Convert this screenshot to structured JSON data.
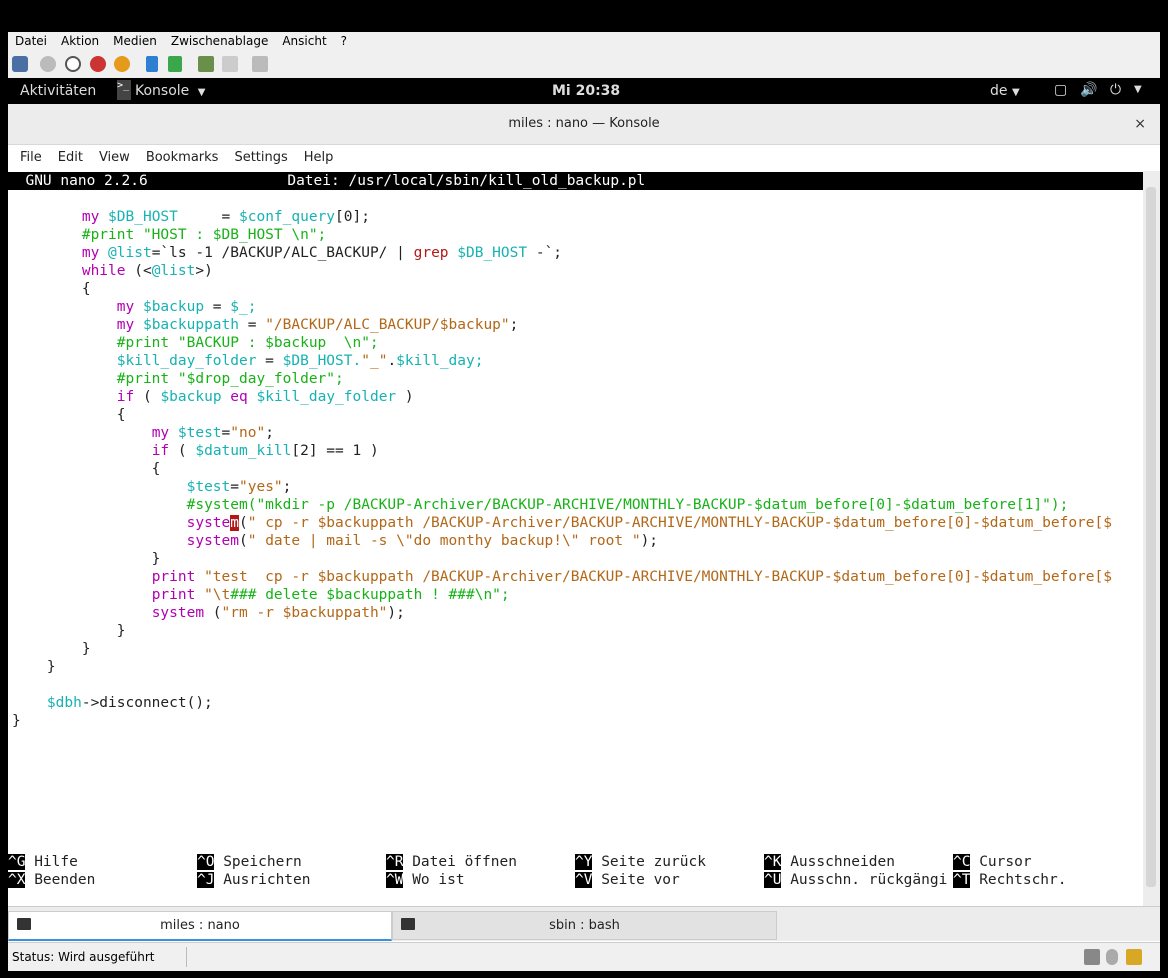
{
  "vm": {
    "menu": [
      "Datei",
      "Aktion",
      "Medien",
      "Zwischenablage",
      "Ansicht",
      "?"
    ],
    "status": "Status: Wird ausgeführt"
  },
  "gnome": {
    "activities": "Aktivitäten",
    "app_name": "Konsole",
    "clock": "Mi 20:38",
    "lang": "de",
    "app_icon_text": ">_"
  },
  "window": {
    "title": "miles : nano — Konsole",
    "close": "×",
    "menu": [
      "File",
      "Edit",
      "View",
      "Bookmarks",
      "Settings",
      "Help"
    ]
  },
  "nano": {
    "header": "  GNU nano 2.2.6                Datei: /usr/local/sbin/kill_old_backup.pl",
    "help": [
      {
        "key": "^G",
        "label": "Hilfe"
      },
      {
        "key": "^O",
        "label": "Speichern"
      },
      {
        "key": "^R",
        "label": "Datei öffnen"
      },
      {
        "key": "^Y",
        "label": "Seite zurück"
      },
      {
        "key": "^K",
        "label": "Ausschneiden"
      },
      {
        "key": "^C",
        "label": "Cursor"
      },
      {
        "key": "^X",
        "label": "Beenden"
      },
      {
        "key": "^J",
        "label": "Ausrichten"
      },
      {
        "key": "^W",
        "label": "Wo ist"
      },
      {
        "key": "^V",
        "label": "Seite vor"
      },
      {
        "key": "^U",
        "label": "Ausschn. rückgängi"
      },
      {
        "key": "^T",
        "label": "Rechtschr."
      }
    ]
  },
  "code": [
    [
      [
        "",
        "        "
      ],
      [
        "kw",
        "my "
      ],
      [
        "var",
        "$DB_HOST"
      ],
      [
        "",
        "     = "
      ],
      [
        "var",
        "$conf_query"
      ],
      [
        "",
        "[0];"
      ]
    ],
    [
      [
        "",
        "        "
      ],
      [
        "cm",
        "#print \"HOST : $DB_HOST \\n\";"
      ]
    ],
    [
      [
        "",
        "        "
      ],
      [
        "kw",
        "my "
      ],
      [
        "var",
        "@list"
      ],
      [
        "",
        "=`ls -1 /BACKUP/ALC_BACKUP/ | "
      ],
      [
        "op",
        "grep"
      ],
      [
        "",
        " "
      ],
      [
        "var",
        "$DB_HOST"
      ],
      [
        "",
        " -`;"
      ]
    ],
    [
      [
        "",
        "        "
      ],
      [
        "kw",
        "while"
      ],
      [
        "",
        " (<"
      ],
      [
        "var",
        "@list"
      ],
      [
        "",
        ">)"
      ]
    ],
    [
      [
        "",
        "        {"
      ]
    ],
    [
      [
        "",
        "            "
      ],
      [
        "kw",
        "my "
      ],
      [
        "var",
        "$backup"
      ],
      [
        "",
        " = "
      ],
      [
        "var",
        "$_;"
      ]
    ],
    [
      [
        "",
        "            "
      ],
      [
        "kw",
        "my "
      ],
      [
        "var",
        "$backuppath"
      ],
      [
        "",
        " = "
      ],
      [
        "str",
        "\"/BACKUP/ALC_BACKUP/$backup\""
      ],
      [
        "",
        ";"
      ]
    ],
    [
      [
        "",
        "            "
      ],
      [
        "cm",
        "#print \"BACKUP : $backup  \\n\";"
      ]
    ],
    [
      [
        "",
        "            "
      ],
      [
        "var",
        "$kill_day_folder"
      ],
      [
        "",
        " = "
      ],
      [
        "var",
        "$DB_HOST."
      ],
      [
        "str",
        "\"_\""
      ],
      [
        "",
        "."
      ],
      [
        "var",
        "$kill_day;"
      ]
    ],
    [
      [
        "",
        "            "
      ],
      [
        "cm",
        "#print \"$drop_day_folder\";"
      ]
    ],
    [
      [
        "",
        "            "
      ],
      [
        "kw",
        "if"
      ],
      [
        "",
        " ( "
      ],
      [
        "var",
        "$backup"
      ],
      [
        "",
        " "
      ],
      [
        "kw",
        "eq"
      ],
      [
        "",
        " "
      ],
      [
        "var",
        "$kill_day_folder"
      ],
      [
        "",
        " )"
      ]
    ],
    [
      [
        "",
        "            {"
      ]
    ],
    [
      [
        "",
        "                "
      ],
      [
        "kw",
        "my "
      ],
      [
        "var",
        "$test"
      ],
      [
        "",
        "="
      ],
      [
        "str",
        "\"no\""
      ],
      [
        "",
        ";"
      ]
    ],
    [
      [
        "",
        "                "
      ],
      [
        "kw",
        "if"
      ],
      [
        "",
        " ( "
      ],
      [
        "var",
        "$datum_kill"
      ],
      [
        "",
        "[2] == 1 )"
      ]
    ],
    [
      [
        "",
        "                {"
      ]
    ],
    [
      [
        "",
        "                    "
      ],
      [
        "var",
        "$test"
      ],
      [
        "",
        "="
      ],
      [
        "str",
        "\"yes\""
      ],
      [
        "",
        ";"
      ]
    ],
    [
      [
        "",
        "                    "
      ],
      [
        "cm",
        "#system(\"mkdir -p /BACKUP-Archiver/BACKUP-ARCHIVE/MONTHLY-BACKUP-$datum_before[0]-$datum_before[1]\");"
      ]
    ],
    [
      [
        "",
        "                    "
      ],
      [
        "kw",
        "syste"
      ],
      [
        "cur",
        "m"
      ],
      [
        "",
        "("
      ],
      [
        "str",
        "\" cp -r $backuppath /BACKUP-Archiver/BACKUP-ARCHIVE/MONTHLY-BACKUP-$datum_before[0]-$datum_before[$"
      ]
    ],
    [
      [
        "",
        "                    "
      ],
      [
        "kw",
        "system"
      ],
      [
        "",
        "("
      ],
      [
        "str",
        "\" date | mail -s \\\"do monthy backup!\\\" root \""
      ],
      [
        "",
        ");"
      ]
    ],
    [
      [
        "",
        "                }"
      ]
    ],
    [
      [
        "",
        "                "
      ],
      [
        "kw",
        "print"
      ],
      [
        "",
        " "
      ],
      [
        "str",
        "\"test  cp -r $backuppath /BACKUP-Archiver/BACKUP-ARCHIVE/MONTHLY-BACKUP-$datum_before[0]-$datum_before[$"
      ]
    ],
    [
      [
        "",
        "                "
      ],
      [
        "kw",
        "print"
      ],
      [
        "",
        " "
      ],
      [
        "str",
        "\"\\t"
      ],
      [
        "cm",
        "### delete $backuppath ! ###\\n\";"
      ]
    ],
    [
      [
        "",
        "                "
      ],
      [
        "kw",
        "system"
      ],
      [
        "",
        " ("
      ],
      [
        "str",
        "\"rm -r $backuppath\""
      ],
      [
        "",
        ");"
      ]
    ],
    [
      [
        "",
        "            }"
      ]
    ],
    [
      [
        "",
        "        }"
      ]
    ],
    [
      [
        "",
        "    }"
      ]
    ],
    [
      [
        "",
        " "
      ]
    ],
    [
      [
        "",
        "    "
      ],
      [
        "var",
        "$dbh"
      ],
      [
        "",
        "->disconnect();"
      ]
    ],
    [
      [
        "",
        "}"
      ]
    ]
  ],
  "tabs": [
    {
      "label": "miles : nano",
      "active": true
    },
    {
      "label": "sbin : bash",
      "active": false
    }
  ],
  "colors": {
    "tab_underline": "#3b8fe0",
    "cursor": "#b21818"
  }
}
